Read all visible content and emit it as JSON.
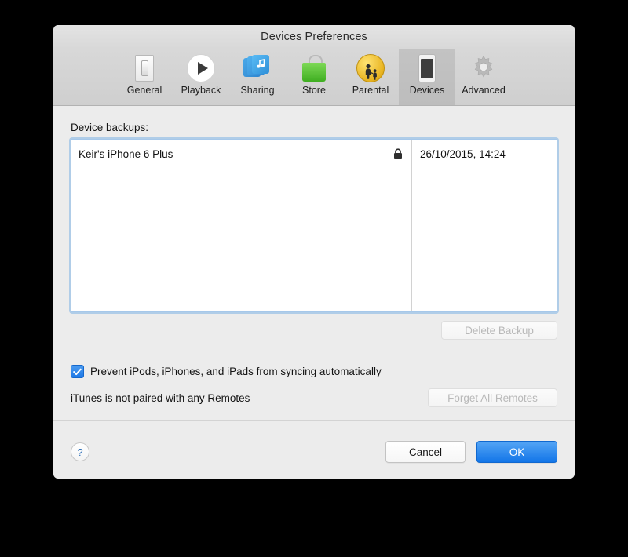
{
  "window": {
    "title": "Devices Preferences"
  },
  "toolbar": {
    "items": [
      {
        "label": "General",
        "icon": "light-switch-icon",
        "selected": false
      },
      {
        "label": "Playback",
        "icon": "play-circle-icon",
        "selected": false
      },
      {
        "label": "Sharing",
        "icon": "shared-library-icon",
        "selected": false
      },
      {
        "label": "Store",
        "icon": "shopping-bag-icon",
        "selected": false
      },
      {
        "label": "Parental",
        "icon": "parental-controls-icon",
        "selected": false
      },
      {
        "label": "Devices",
        "icon": "iphone-icon",
        "selected": true
      },
      {
        "label": "Advanced",
        "icon": "gear-icon",
        "selected": false
      }
    ]
  },
  "main": {
    "backups_label": "Device backups:",
    "backups": [
      {
        "name": "Keir's iPhone 6 Plus",
        "encrypted_icon": "lock-icon",
        "date": "26/10/2015, 14:24"
      }
    ],
    "delete_backup_label": "Delete Backup",
    "delete_backup_enabled": false,
    "prevent_sync_label": "Prevent iPods, iPhones, and iPads from syncing automatically",
    "prevent_sync_checked": true,
    "remotes_status": "iTunes is not paired with any Remotes",
    "forget_remotes_label": "Forget All Remotes",
    "forget_remotes_enabled": false
  },
  "footer": {
    "help_label": "?",
    "cancel_label": "Cancel",
    "ok_label": "OK"
  },
  "colors": {
    "accent": "#1275e8",
    "window_bg": "#ececec",
    "toolbar_bg": "#d4d4d4",
    "focus_ring": "#80b4e6",
    "desktop_bg": "#000000"
  }
}
